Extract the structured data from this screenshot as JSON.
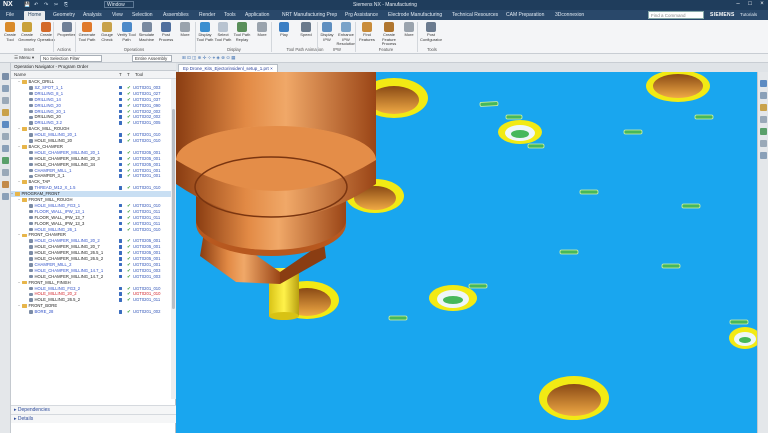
{
  "app": {
    "logo": "NX",
    "window_selector": "Window",
    "title": "Siemens NX - Manufacturing",
    "siemens": "SIEMENS",
    "search_placeholder": "Find a Command",
    "tutorials": "Tutorials",
    "window_minimize": "–",
    "window_maximize": "□",
    "window_close": "×"
  },
  "quick_access": [
    "💾",
    "↶",
    "↷",
    "✂",
    "⎘"
  ],
  "menu": [
    "File",
    "Home",
    "Geometry",
    "Analysis",
    "View",
    "Selection",
    "Assemblies",
    "Render",
    "Tools",
    "Application",
    "NRT Manufacturing Prep",
    "Prg Assistance",
    "Electrode Manufacturing",
    "Technical Resources",
    "CAM Preparation",
    "3Dconnexion"
  ],
  "menu_active": "Home",
  "ribbon": {
    "buttons": [
      {
        "label": "Create Tool",
        "color": "#d98b2b"
      },
      {
        "label": "Create Geometry",
        "color": "#c9a13a"
      },
      {
        "label": "Create Operation",
        "color": "#d36a2a"
      },
      {
        "label": "Properties",
        "color": "#6f7f96"
      },
      {
        "label": "Generate Tool Path",
        "color": "#e07a2c"
      },
      {
        "label": "Gouge Check",
        "color": "#c8a24b"
      },
      {
        "label": "Verify Tool Path",
        "color": "#4d8ac9"
      },
      {
        "label": "Simulate Machine",
        "color": "#7a8aa0"
      },
      {
        "label": "Post Process",
        "color": "#4f6f9e"
      },
      {
        "label": "More",
        "color": "#9aa3ad"
      },
      {
        "label": "Display Tool Path",
        "color": "#3b8fd0"
      },
      {
        "label": "Select Tool Path",
        "color": "#b8c3d0"
      },
      {
        "label": "Tool Path Replay",
        "color": "#5a8f5a"
      },
      {
        "label": "More",
        "color": "#9aa3ad"
      },
      {
        "label": "Play",
        "color": "#3c7fc4"
      },
      {
        "label": "Speed",
        "color": "#6a7a8c"
      },
      {
        "label": "Display IPW",
        "color": "#5f8fc0"
      },
      {
        "label": "Enhance IPW Resolution",
        "color": "#7aa3c9"
      },
      {
        "label": "Find Features",
        "color": "#c98c3a"
      },
      {
        "label": "Create Feature Process",
        "color": "#b0762f"
      },
      {
        "label": "More",
        "color": "#9aa3ad"
      },
      {
        "label": "Post Configurator",
        "color": "#6b7b8f"
      }
    ],
    "groups": [
      "Insert",
      "Actions",
      "Operations",
      "Display",
      "Tool Path Animation",
      "IPW",
      "Feature",
      "Tools"
    ]
  },
  "filterbar": {
    "menu": "Menu",
    "type_filter": "No Selection Filter",
    "scope": "Entire Assembly"
  },
  "viewport_tab": "Ep Drone_Kits_Ejectorinsidenl_setup_1.prt",
  "navigator": {
    "title": "Operation Navigator - Program Order",
    "columns": {
      "name": "Name",
      "path": "T",
      "check": "T",
      "tool": "Tool"
    },
    "rows": [
      {
        "level": 1,
        "kind": "group",
        "name": "BACK_DRILL",
        "tool": ""
      },
      {
        "level": 2,
        "kind": "op",
        "name": "SZ_SPOT_1_1",
        "tool": "UGT0201_003",
        "blue": true
      },
      {
        "level": 2,
        "kind": "op",
        "name": "DRILLING_8_1",
        "tool": "UGT0201_027",
        "blue": true
      },
      {
        "level": 2,
        "kind": "op",
        "name": "DRILLING_14",
        "tool": "UGT0201_037",
        "blue": true
      },
      {
        "level": 2,
        "kind": "op",
        "name": "DRILLING_20",
        "tool": "UGT0201_090",
        "blue": true
      },
      {
        "level": 2,
        "kind": "op",
        "name": "DRILLING_20_1",
        "tool": "UGT0202_002",
        "blue": true
      },
      {
        "level": 2,
        "kind": "op",
        "name": "DRILLING_20",
        "tool": "UGT0202_002",
        "blue": false
      },
      {
        "level": 2,
        "kind": "op",
        "name": "DRILLING_3.2",
        "tool": "UGT0201_005",
        "blue": true
      },
      {
        "level": 1,
        "kind": "group",
        "name": "BACK_MILL_ROUGH",
        "tool": ""
      },
      {
        "level": 2,
        "kind": "op",
        "name": "HOLE_MILLING_20_1",
        "tool": "UGT0201_010",
        "blue": true
      },
      {
        "level": 2,
        "kind": "op",
        "name": "HOLE_MILLING_20",
        "tool": "UGT0201_010",
        "blue": false
      },
      {
        "level": 1,
        "kind": "group",
        "name": "BACK_CHAMFER",
        "tool": ""
      },
      {
        "level": 2,
        "kind": "op",
        "name": "HOLE_CHAMFER_MILLING_20_1",
        "tool": "UGT0205_001",
        "blue": true
      },
      {
        "level": 2,
        "kind": "op",
        "name": "HOLE_CHAMFER_MILLING_20_3",
        "tool": "UGT0205_001",
        "blue": false
      },
      {
        "level": 2,
        "kind": "op",
        "name": "HOLE_CHAMFER_MILLING_34",
        "tool": "UGT0205_001",
        "blue": false
      },
      {
        "level": 2,
        "kind": "op",
        "name": "CHAMFER_MILL_1",
        "tool": "UGT0201_001",
        "blue": true
      },
      {
        "level": 2,
        "kind": "op",
        "name": "CHAMFER_3_1",
        "tool": "UGT0201_001",
        "blue": false
      },
      {
        "level": 1,
        "kind": "group",
        "name": "BACK_TAP",
        "tool": ""
      },
      {
        "level": 2,
        "kind": "op",
        "name": "THREAD_M12_X_1.5",
        "tool": "UGT0201_010",
        "blue": true
      },
      {
        "level": 0,
        "kind": "group",
        "name": "PROGRAM_FRONT",
        "tool": "",
        "selected": true
      },
      {
        "level": 1,
        "kind": "group",
        "name": "FRONT_MILL_ROUGH",
        "tool": ""
      },
      {
        "level": 2,
        "kind": "op",
        "name": "HOLE_MILLING_FG3_1",
        "tool": "UGT0201_010",
        "blue": true
      },
      {
        "level": 2,
        "kind": "op",
        "name": "FLOOR_WALL_IPW_13_1",
        "tool": "UGT0201_011",
        "blue": true
      },
      {
        "level": 2,
        "kind": "op",
        "name": "FLOOR_WALL_IPW_13_7",
        "tool": "UGT0201_011",
        "blue": false
      },
      {
        "level": 2,
        "kind": "op",
        "name": "FLOOR_WALL_IPW_13_3",
        "tool": "UGT0201_011",
        "blue": false
      },
      {
        "level": 2,
        "kind": "op",
        "name": "HOLE_MILLING_26_1",
        "tool": "UGT0201_010",
        "blue": true
      },
      {
        "level": 1,
        "kind": "group",
        "name": "FRONT_CHAMFER",
        "tool": ""
      },
      {
        "level": 2,
        "kind": "op",
        "name": "HOLE_CHAMFER_MILLING_20_2",
        "tool": "UGT0205_001",
        "blue": true
      },
      {
        "level": 2,
        "kind": "op",
        "name": "HOLE_CHAMFER_MILLING_20_7",
        "tool": "UGT0205_001",
        "blue": false
      },
      {
        "level": 2,
        "kind": "op",
        "name": "HOLE_CHAMFER_MILLING_26.5_1",
        "tool": "UGT0205_001",
        "blue": false
      },
      {
        "level": 2,
        "kind": "op",
        "name": "HOLE_CHAMFER_MILLING_26.5_2",
        "tool": "UGT0205_001",
        "blue": false
      },
      {
        "level": 2,
        "kind": "op",
        "name": "CHAMFER_MILL_2",
        "tool": "UGT0201_001",
        "blue": true
      },
      {
        "level": 2,
        "kind": "op",
        "name": "HOLE_CHAMFER_MILLING_14.7_1",
        "tool": "UGT0201_003",
        "blue": true
      },
      {
        "level": 2,
        "kind": "op",
        "name": "HOLE_CHAMFER_MILLING_14.7_2",
        "tool": "UGT0201_003",
        "blue": false
      },
      {
        "level": 1,
        "kind": "group",
        "name": "FRONT_MILL_FINISH",
        "tool": ""
      },
      {
        "level": 2,
        "kind": "op",
        "name": "HOLE_MILLING_FG3_2",
        "tool": "UGT0201_010",
        "blue": true
      },
      {
        "level": 2,
        "kind": "op",
        "name": "HOLE_MILLING_20_2",
        "tool": "UGT0201_010",
        "red": true
      },
      {
        "level": 2,
        "kind": "op",
        "name": "HOLE_MILLING_26.5_2",
        "tool": "UGT0201_011",
        "blue": false
      },
      {
        "level": 1,
        "kind": "group",
        "name": "FRONT_BORE",
        "tool": ""
      },
      {
        "level": 2,
        "kind": "op",
        "name": "BORE_28",
        "tool": "UGT0201_002",
        "blue": true
      }
    ],
    "panels": [
      "Dependencies",
      "Details"
    ]
  },
  "colors": {
    "viewport_bg": "#19a6ef",
    "tool_orange": "#d9772f",
    "hole_yellow": "#f2ea14",
    "accent_green": "#46b85a"
  }
}
